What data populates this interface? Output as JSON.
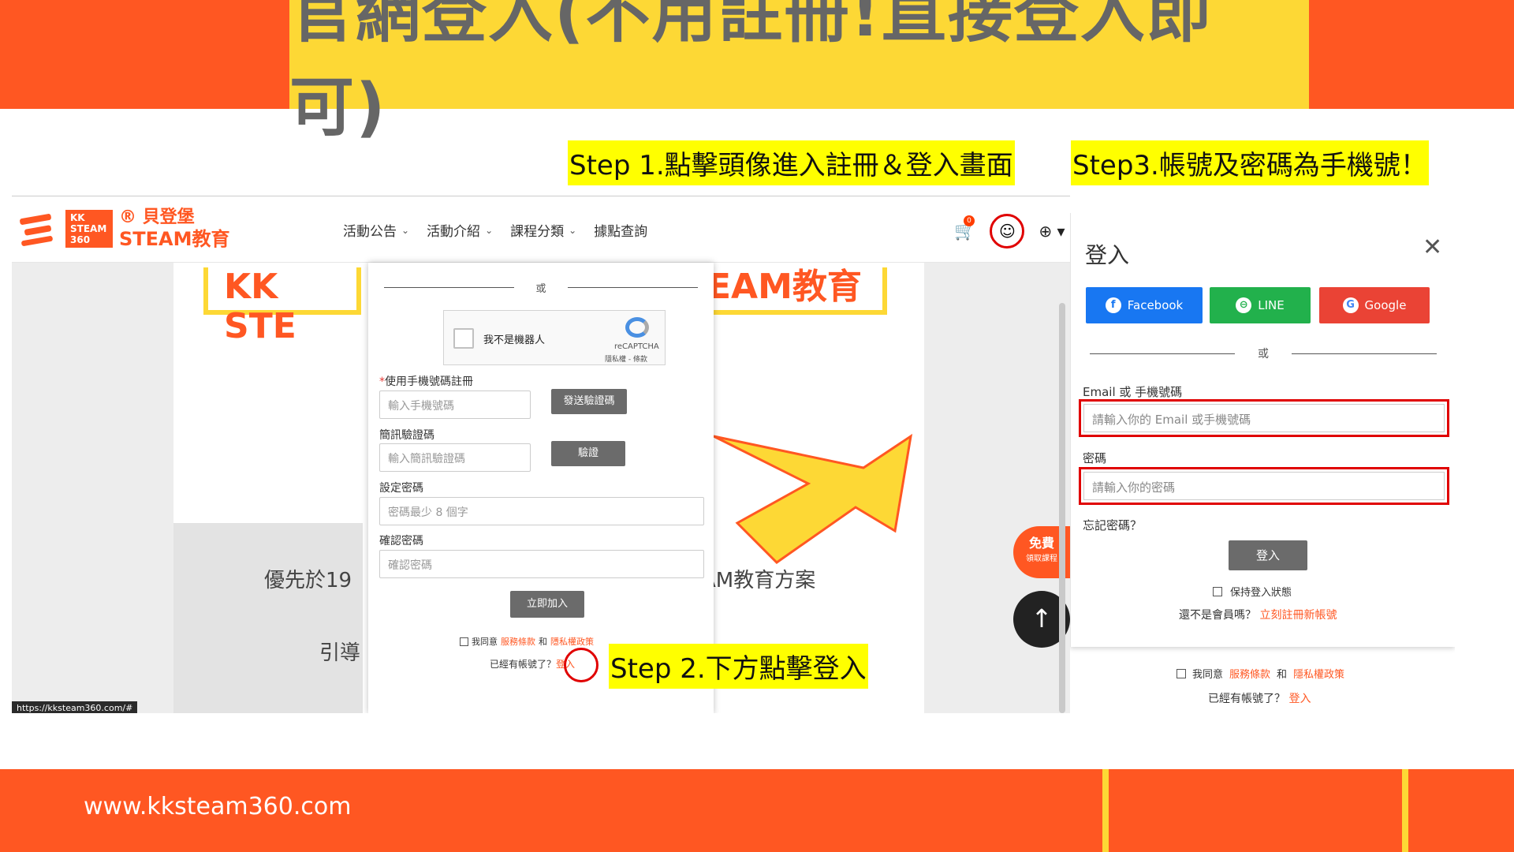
{
  "slide": {
    "title": "官網登入(不用註冊!直接登入即可)",
    "step1": "Step 1.點擊頭像進入註冊＆登入畫面",
    "step2": "Step 2.下方點擊登入",
    "step3": "Step3.帳號及密碼為手機號！",
    "footer_url": "www.kksteam360.com",
    "colors": {
      "orange": "#ff5722",
      "yellow": "#fdd835",
      "highlight": "#ffff00",
      "annotation_red": "#e00000"
    }
  },
  "navbar": {
    "logo_box": "KK STEAM 360",
    "logo_line1": "® 貝登堡",
    "logo_line2": "STEAM教育",
    "menu": [
      {
        "label": "活動公告",
        "icon": "chevron-down-icon"
      },
      {
        "label": "活動介紹",
        "icon": "chevron-down-icon"
      },
      {
        "label": "課程分類",
        "icon": "chevron-down-icon"
      },
      {
        "label": "據點查詢"
      }
    ],
    "cart_icon": "cart-icon",
    "cart_badge": "0",
    "user_icon": "user-circle-icon",
    "globe_icon": "globe-icon"
  },
  "hero": {
    "sign_left": "KK STE",
    "sign_right": "EAM教育",
    "text_left1": "優先於19",
    "text_left2": "引導",
    "text_right1": "AM教育方案",
    "free_a": "免費",
    "free_b": "領取課程",
    "to_top_icon": "arrow-up-icon",
    "url_tip": "https://kksteam360.com/#"
  },
  "register_modal": {
    "or": "或",
    "captcha_label": "我不是機器人",
    "captcha_brand": "reCAPTCHA",
    "captcha_links": "隱私權 - 條款",
    "phone_label": "使用手機號碼註冊",
    "phone_required": "*",
    "phone_placeholder": "輸入手機號碼",
    "send_code": "發送驗證碼",
    "sms_label": "簡訊驗證碼",
    "sms_placeholder": "輸入簡訊驗證碼",
    "verify": "驗證",
    "pwd_label": "設定密碼",
    "pwd_placeholder": "密碼最少 8 個字",
    "confirm_label": "確認密碼",
    "confirm_placeholder": "確認密碼",
    "join": "立即加入",
    "agree_prefix": "我同意",
    "terms": "服務條款",
    "and": "和",
    "privacy": "隱私權政策",
    "have_account": "已經有帳號了？",
    "login_link": "登入"
  },
  "login_panel": {
    "title": "登入",
    "close_icon": "close-icon",
    "facebook": "Facebook",
    "line": "LINE",
    "google": "Google",
    "or": "或",
    "account_label": "Email 或 手機號碼",
    "account_placeholder": "請輸入你的 Email 或手機號碼",
    "password_label": "密碼",
    "password_placeholder": "請輸入你的密碼",
    "forgot": "忘記密碼？",
    "login_button": "登入",
    "keep_login": "保持登入狀態",
    "not_member": "還不是會員嗎？",
    "register_link": "立刻註冊新帳號",
    "agree_prefix": "我同意",
    "terms": "服務條款",
    "and": "和",
    "privacy": "隱私權政策",
    "have_account": "已經有帳號了？",
    "login_link": "登入",
    "colors": {
      "facebook": "#1877f2",
      "line": "#22b14c",
      "google": "#ea4335"
    }
  }
}
